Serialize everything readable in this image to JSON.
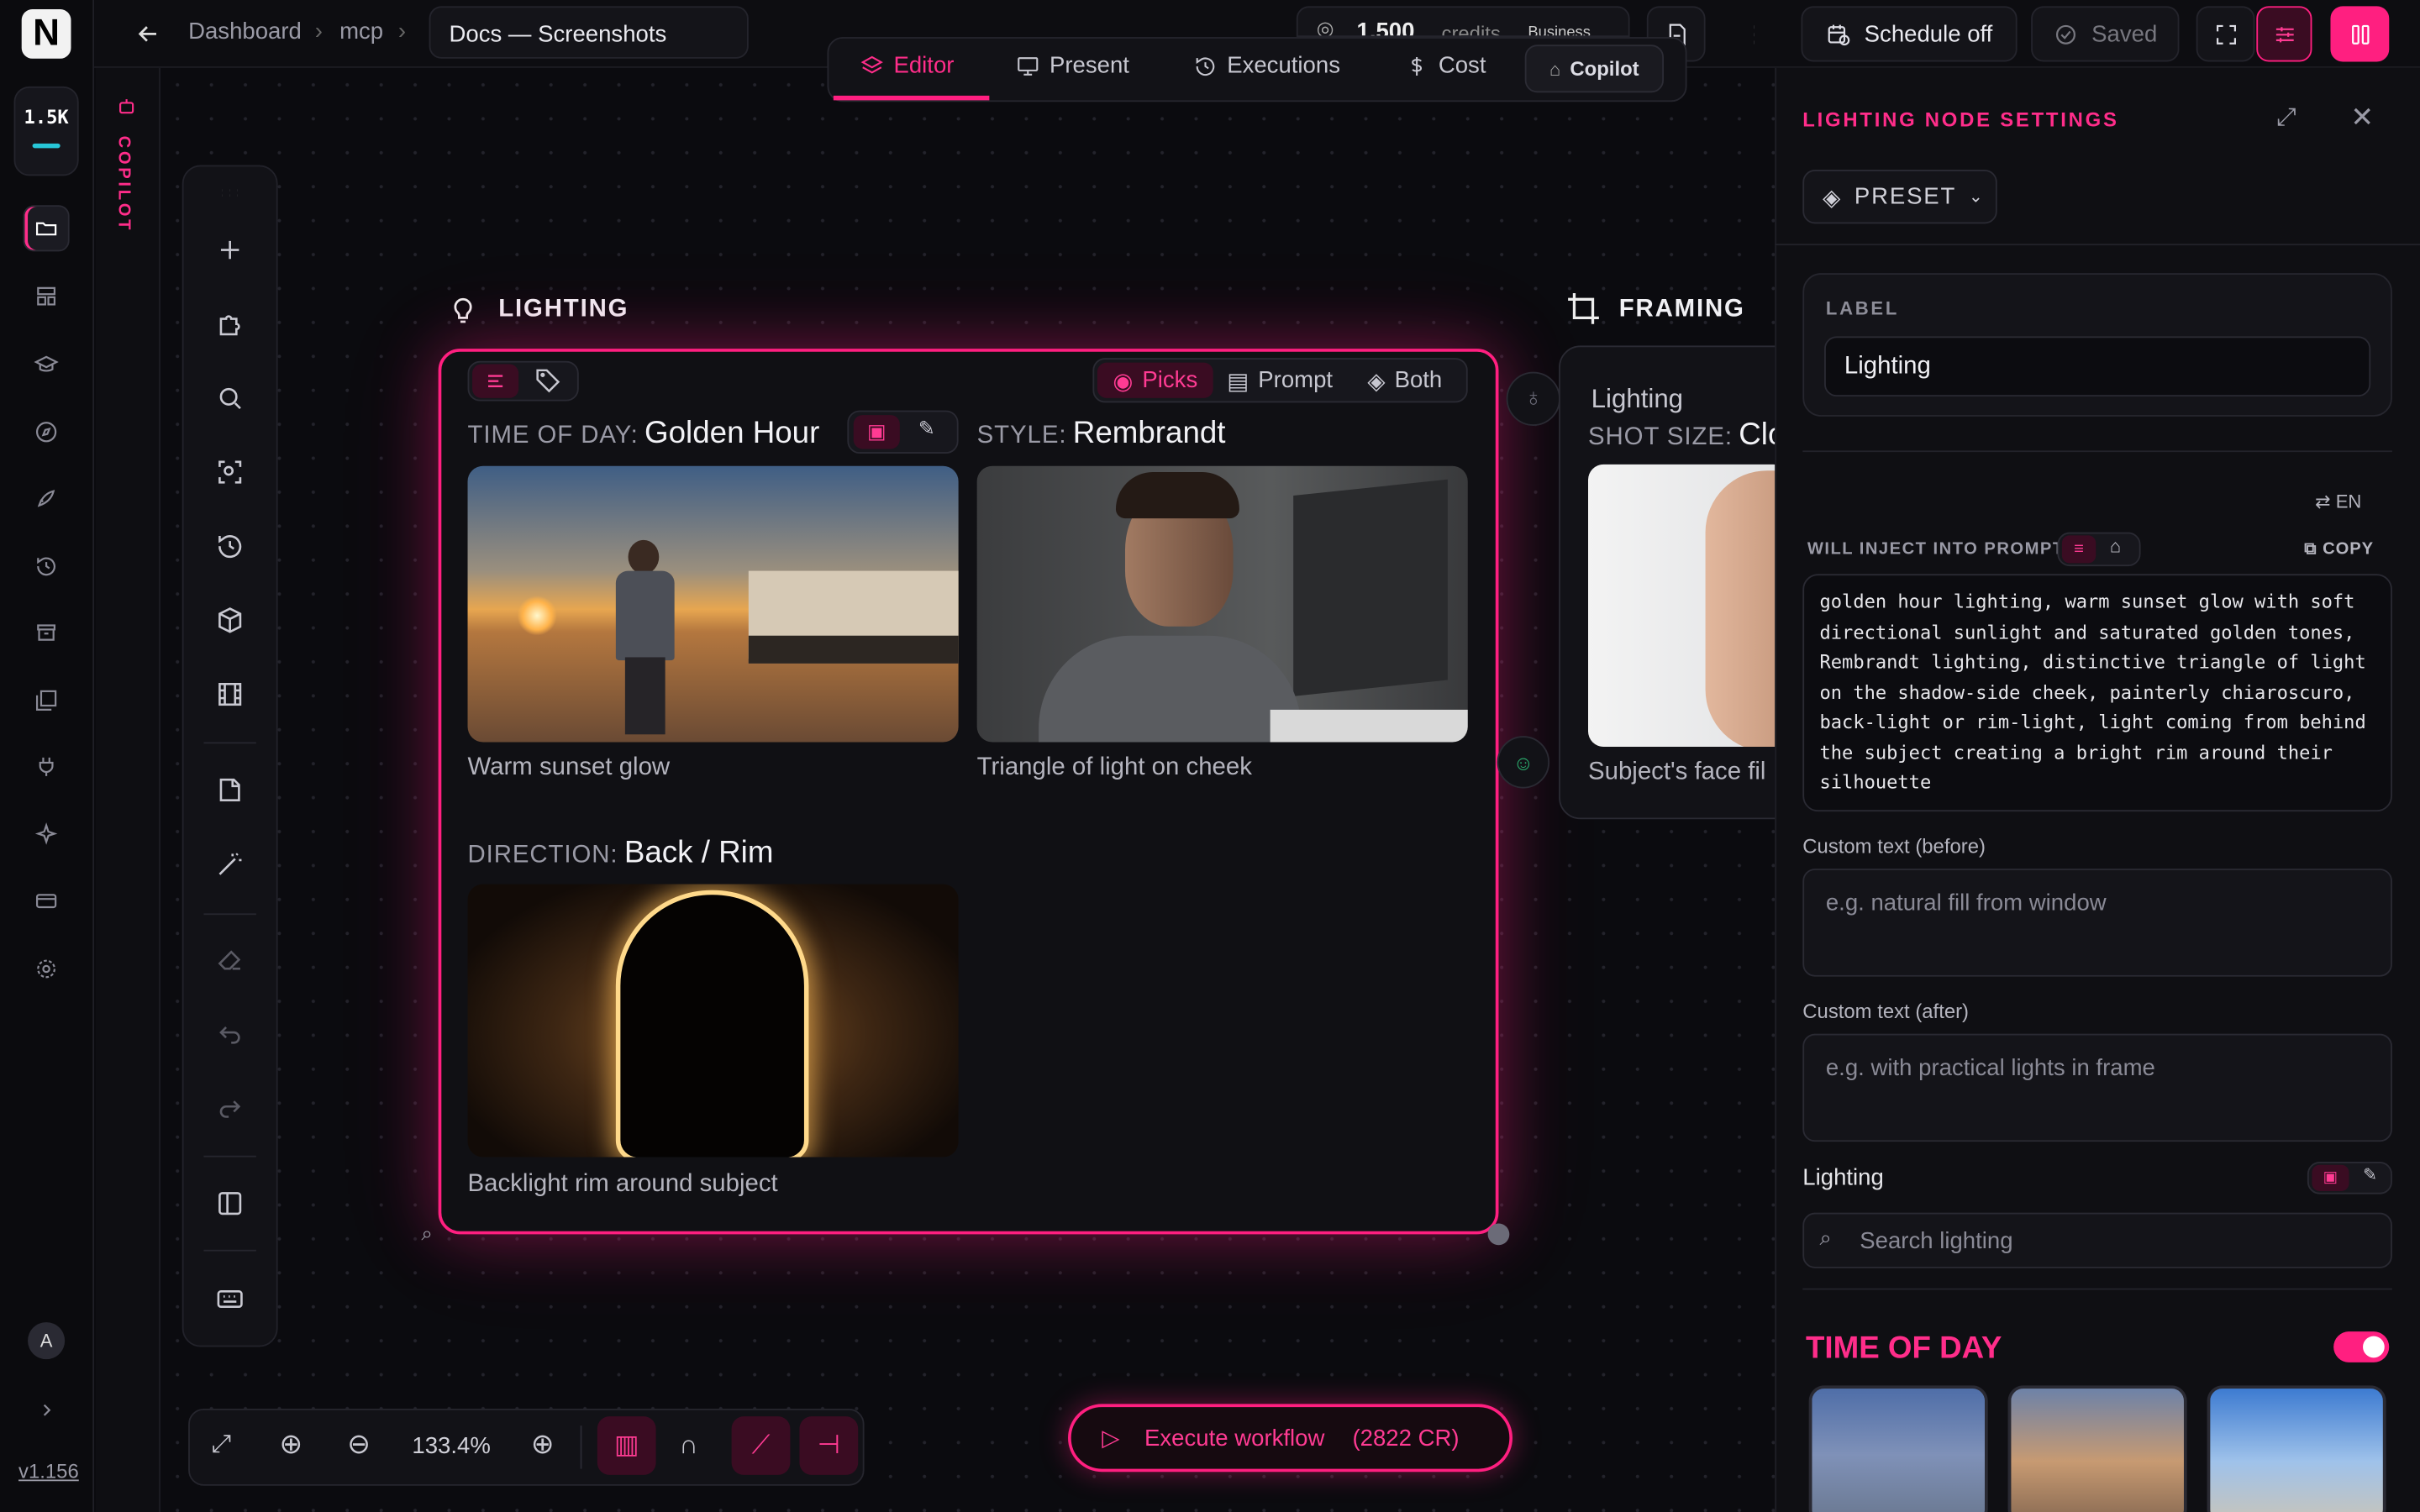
{
  "sidebar": {
    "logo": "N",
    "credits_short": "1.5K",
    "avatar": "A",
    "version": "v1.156"
  },
  "copilot_strip": {
    "label": "COPILOT"
  },
  "topbar": {
    "breadcrumb": [
      "Dashboard",
      "mcp"
    ],
    "doc_name": "Docs — Screenshots",
    "credits_value": "1,500",
    "credits_label": "credits",
    "plan": "Business",
    "schedule_label": "Schedule off",
    "saved_label": "Saved"
  },
  "modes": {
    "editor": "Editor",
    "present": "Present",
    "executions": "Executions",
    "cost": "Cost",
    "copilot": "Copilot"
  },
  "node": {
    "title": "LIGHTING",
    "view_picks": "Picks",
    "view_prompt": "Prompt",
    "view_both": "Both",
    "time_label": "TIME OF DAY:",
    "time_value": "Golden Hour",
    "time_caption": "Warm sunset glow",
    "style_label": "STYLE:",
    "style_value": "Rembrandt",
    "style_caption": "Triangle of light on cheek",
    "direction_label": "DIRECTION:",
    "direction_value": "Back / Rim",
    "direction_caption": "Backlight rim around subject"
  },
  "node2": {
    "title": "FRAMING",
    "lighting": "Lighting",
    "shot_label": "SHOT SIZE:",
    "shot_value": "Clo",
    "caption": "Subject's face fil"
  },
  "zoom": {
    "level": "133.4%"
  },
  "execute": {
    "label": "Execute workflow",
    "cost": "(2822 CR)"
  },
  "panel": {
    "title": "LIGHTING NODE SETTINGS",
    "preset": "PRESET",
    "label_heading": "LABEL",
    "label_value": "Lighting",
    "lang": "EN",
    "inject_heading": "WILL INJECT INTO PROMPT",
    "copy": "COPY",
    "inject_lines": [
      "golden hour lighting, warm sunset glow with soft",
      "directional sunlight and saturated golden tones,",
      "Rembrandt lighting, distinctive triangle of light",
      "on the shadow-side cheek, painterly chiaroscuro,",
      "back-light or rim-light, light coming from behind",
      "the subject creating a bright rim around their",
      "silhouette"
    ],
    "before_label": "Custom text (before)",
    "before_placeholder": "e.g. natural fill from window",
    "after_label": "Custom text (after)",
    "after_placeholder": "e.g. with practical lights in frame",
    "lighting_label": "Lighting",
    "search_placeholder": "Search lighting",
    "time_heading": "TIME OF DAY",
    "time_toggle": true
  },
  "colors": {
    "accent": "#ff1f80",
    "bg": "#0b0b0f",
    "panel": "#0f0f13"
  }
}
